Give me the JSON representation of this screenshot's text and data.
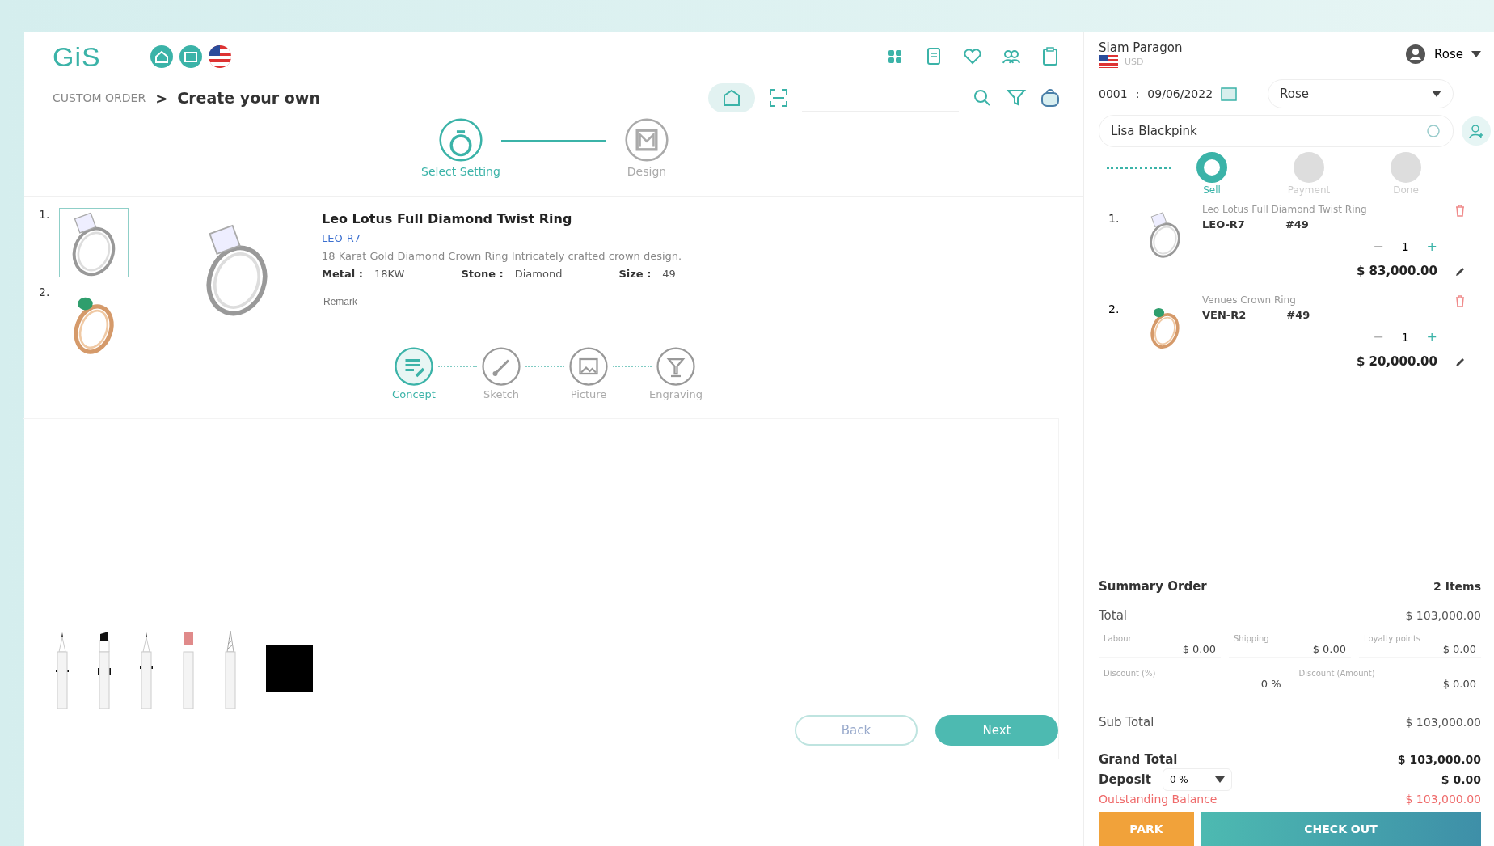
{
  "header": {
    "logo": "GiS",
    "breadcrumb": {
      "parent": "CUSTOM ORDER",
      "separator": ">",
      "current": "Create your own"
    }
  },
  "main_steps": [
    {
      "label": "Select Setting",
      "kind": "ring",
      "selected": true
    },
    {
      "label": "Design",
      "kind": "design",
      "selected": false
    }
  ],
  "thumbnails": [
    {
      "index": "1.",
      "kind": "diamond",
      "selected": true
    },
    {
      "index": "2.",
      "kind": "emerald",
      "selected": false
    }
  ],
  "product": {
    "name": "Leo Lotus Full Diamond Twist Ring",
    "code": "LEO-R7",
    "description": "18 Karat Gold Diamond Crown Ring Intricately crafted crown design.",
    "attributes": [
      {
        "label": "Metal :",
        "value": "18KW"
      },
      {
        "label": "Stone :",
        "value": "Diamond"
      },
      {
        "label": "Size :",
        "value": "49"
      }
    ],
    "remark_placeholder": "Remark"
  },
  "design_steps": [
    {
      "label": "Concept",
      "kind": "concept",
      "selected": true
    },
    {
      "label": "Sketch",
      "kind": "sketch",
      "selected": false
    },
    {
      "label": "Picture",
      "kind": "picture",
      "selected": false
    },
    {
      "label": "Engraving",
      "kind": "engraving",
      "selected": false
    }
  ],
  "tools": [
    {
      "kind": "pen"
    },
    {
      "kind": "marker"
    },
    {
      "kind": "pencil"
    },
    {
      "kind": "eraser"
    },
    {
      "kind": "drill"
    },
    {
      "kind": "swatch",
      "color": "#000000"
    }
  ],
  "buttons": [
    {
      "label": "Back",
      "kind": "secondary"
    },
    {
      "label": "Next",
      "kind": "primary"
    }
  ],
  "order_panel": {
    "store": "Siam Paragon",
    "currency": "USD",
    "user": "Rose",
    "order_no": "0001",
    "separator": ":",
    "date": "09/06/2022",
    "salesperson": "Rose",
    "customer": "Lisa Blackpink",
    "steps": [
      {
        "label": "Sell",
        "selected": true
      },
      {
        "label": "Payment",
        "selected": false
      },
      {
        "label": "Done",
        "selected": false
      }
    ],
    "items": [
      {
        "index": "1.",
        "kind": "diamond",
        "name": "Leo Lotus Full Diamond Twist Ring",
        "code": "LEO-R7",
        "size": "#49",
        "minus": "−",
        "quantity": "1",
        "plus": "+",
        "price": "$ 83,000.00"
      },
      {
        "index": "2.",
        "kind": "emerald",
        "name": "Venues Crown Ring",
        "code": "VEN-R2",
        "size": "#49",
        "minus": "−",
        "quantity": "1",
        "plus": "+",
        "price": "$ 20,000.00"
      }
    ],
    "summary": {
      "title": "Summary Order",
      "count": "2 Items",
      "total_label": "Total",
      "total": "$ 103,000.00",
      "fees": [
        {
          "label": "Labour",
          "value": "$ 0.00"
        },
        {
          "label": "Shipping",
          "value": "$ 0.00"
        },
        {
          "label": "Loyalty points",
          "value": "$ 0.00"
        }
      ],
      "discounts": [
        {
          "label": "Discount (%)",
          "value": "0 %"
        },
        {
          "label": "Discount (Amount)",
          "value": "$ 0.00"
        }
      ],
      "subtotal_label": "Sub Total",
      "subtotal": "$ 103,000.00",
      "grand_label": "Grand Total",
      "grand": "$ 103,000.00",
      "deposit_label": "Deposit",
      "deposit_rate": "0 %",
      "deposit": "$ 0.00",
      "outstanding_label": "Outstanding Balance",
      "outstanding": "$ 103,000.00"
    },
    "actions": [
      {
        "label": "PARK",
        "kind": "park"
      },
      {
        "label": "CHECK OUT",
        "kind": "checkout"
      }
    ]
  }
}
